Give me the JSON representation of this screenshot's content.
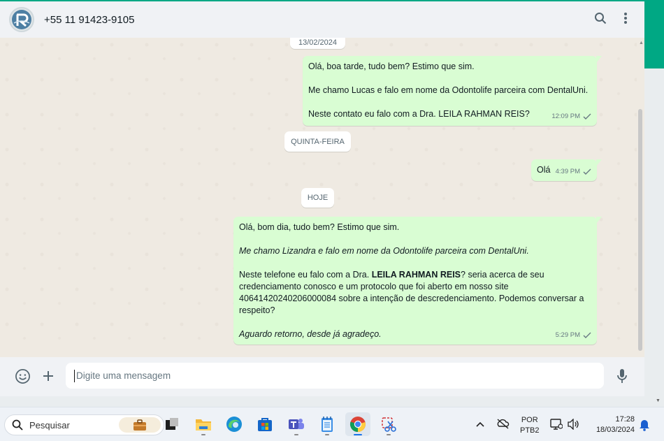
{
  "header": {
    "contact_name": "+55 11 91423-9105",
    "avatar_icon": "company-logo",
    "search_icon": "search-icon",
    "menu_icon": "kebab-menu-icon"
  },
  "chat": {
    "partial_date": "13/02/2024",
    "day_label_1": "QUINTA-FEIRA",
    "day_label_2": "HOJE",
    "messages": [
      {
        "lines": [
          "Olá, boa tarde, tudo bem? Estimo que sim.",
          "Me chamo Lucas e falo em nome da Odontolife parceira com DentalUni.",
          "Neste contato eu falo com a Dra. LEILA RAHMAN REIS?"
        ],
        "time": "12:09 PM"
      },
      {
        "text": "Olá",
        "time": "4:39 PM"
      },
      {
        "line1": "Olá, bom dia, tudo bem? Estimo que sim.",
        "line2": "Me chamo Lizandra e falo em nome da Odontolife parceira com DentalUni.",
        "line3_pre": "Neste telefone eu falo com a Dra. ",
        "line3_bold": "LEILA RAHMAN REIS",
        "line3_post": "? seria acerca de seu credenciamento conosco e um protocolo que foi aberto em nosso site 40641420240206000084 sobre a intenção de descredenciamento. Podemos conversar a respeito?",
        "line4": "Aguardo retorno, desde já agradeço.",
        "time": "5:29 PM"
      }
    ]
  },
  "compose": {
    "placeholder": "Digite uma mensagem",
    "emoji_icon": "emoji-icon",
    "attach_icon": "plus-icon",
    "mic_icon": "microphone-icon"
  },
  "taskbar": {
    "search_label": "Pesquisar",
    "apps": [
      "work-briefcase-icon",
      "task-view-icon",
      "file-explorer-icon",
      "edge-icon",
      "microsoft-store-icon",
      "teams-icon",
      "notepad-icon",
      "chrome-icon",
      "snipping-tool-icon"
    ],
    "lang_line1": "POR",
    "lang_line2": "PTB2",
    "time": "17:28",
    "date": "18/03/2024"
  },
  "colors": {
    "accent": "#00a884",
    "bubble_out": "#d9fdd3",
    "chat_bg": "#efeae2"
  }
}
